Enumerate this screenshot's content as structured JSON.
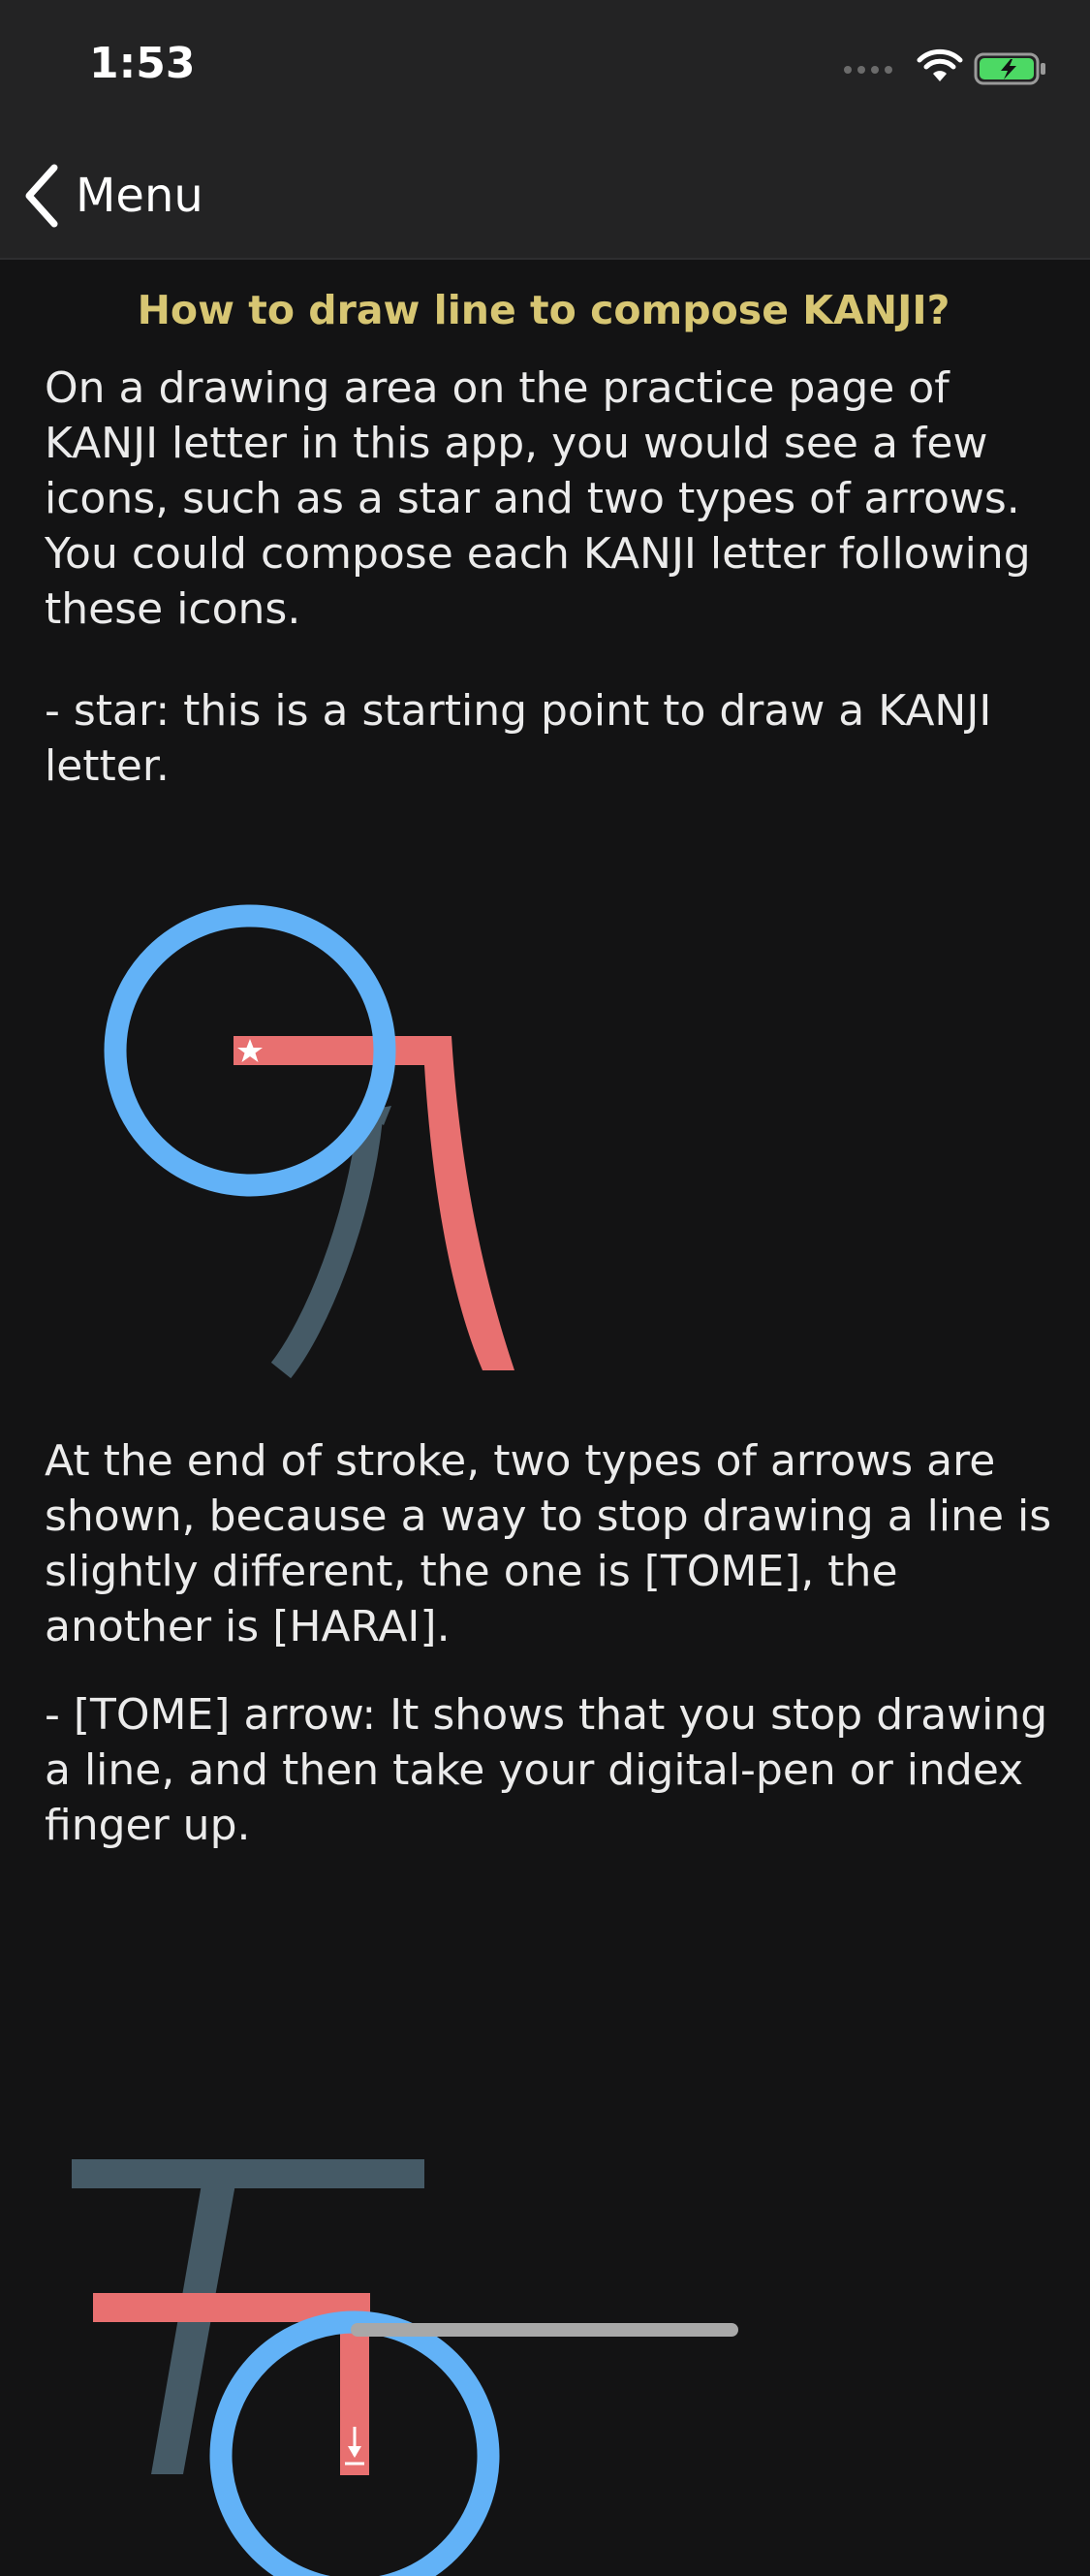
{
  "status_bar": {
    "time": "1:53"
  },
  "nav": {
    "back_label": "Menu"
  },
  "content": {
    "title": "How to draw line to compose KANJI?",
    "paragraphs": [
      "On a drawing area on the practice page of KANJI letter in this app, you would see a few icons, such as a star and two types of arrows. You could compose each KANJI letter following these icons.",
      "- star: this is a starting point to draw a KANJI letter.",
      "At the end of stroke, two types of arrows are shown, because a way to stop drawing a line is slightly different, the one is [TOME], the another is [HARAI].",
      "- [TOME] arrow: It shows that you stop drawing a line, and then take your digital-pen or index finger up."
    ]
  },
  "colors": {
    "accent_title": "#d7c673",
    "circle_blue": "#62b2f7",
    "stroke_red": "#e87070",
    "stroke_slate": "#455a66",
    "battery_green": "#4cd964"
  },
  "icons": {
    "back": "chevron-left-icon",
    "star": "star-icon",
    "tome_arrow": "arrow-down-stop-icon"
  }
}
